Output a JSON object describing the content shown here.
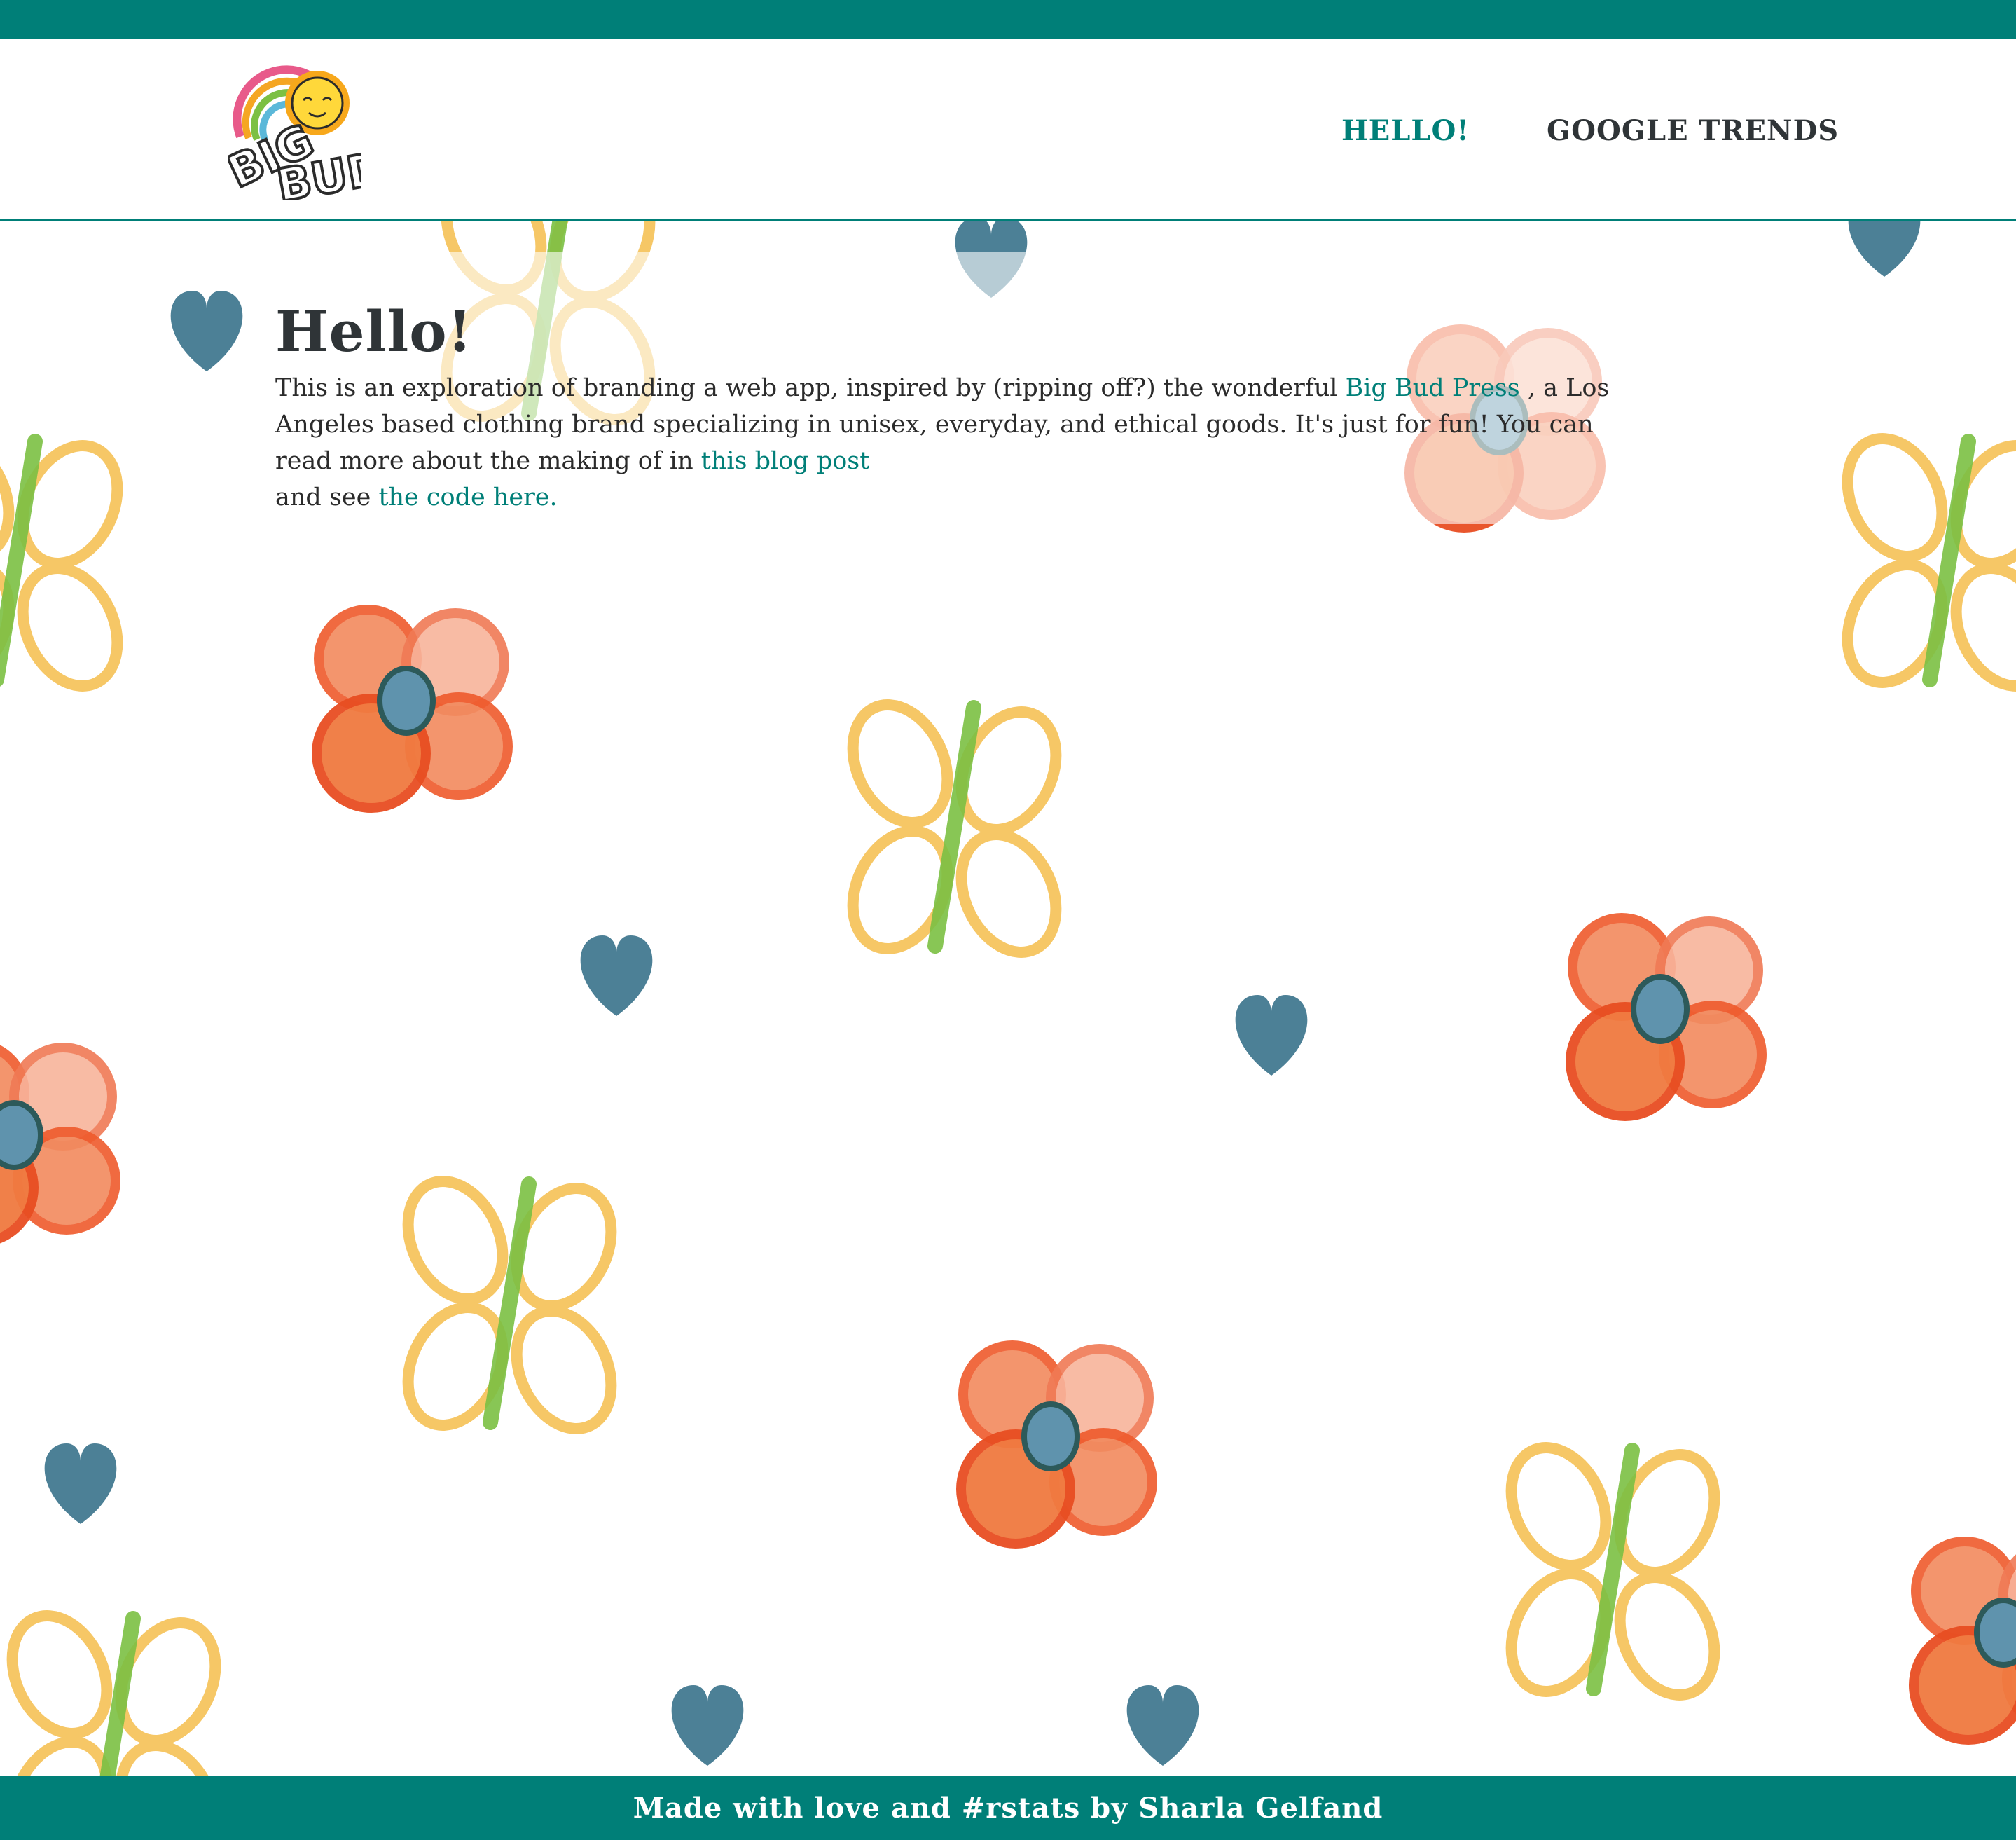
{
  "colors": {
    "brand_teal": "#007f78",
    "text_dark": "#2f3437",
    "flower_red": "#ef5a2c",
    "flower_yellow": "#f7c35a",
    "stem_green": "#7cc043",
    "heart_blue": "#2d6a84"
  },
  "header": {
    "logo_text": "BIG BUD",
    "logo_icons": [
      "rainbow-icon",
      "sun-icon"
    ],
    "nav": [
      {
        "label": "HELLO!",
        "active": true
      },
      {
        "label": "GOOGLE TRENDS",
        "active": false
      }
    ]
  },
  "main": {
    "title": "Hello!",
    "intro_1": "This is an exploration of branding a web app, inspired by (ripping off?) the wonderful ",
    "link_bigbud": "Big Bud Press",
    "intro_2": " , a Los Angeles based clothing brand specializing in unisex, everyday, and ethical goods. It's just for fun! You can read more about the making of in ",
    "link_blog": "this blog post",
    "intro_3": " and see ",
    "link_code": "the code here."
  },
  "footer": {
    "text": "Made with love and #rstats by Sharla Gelfand"
  }
}
